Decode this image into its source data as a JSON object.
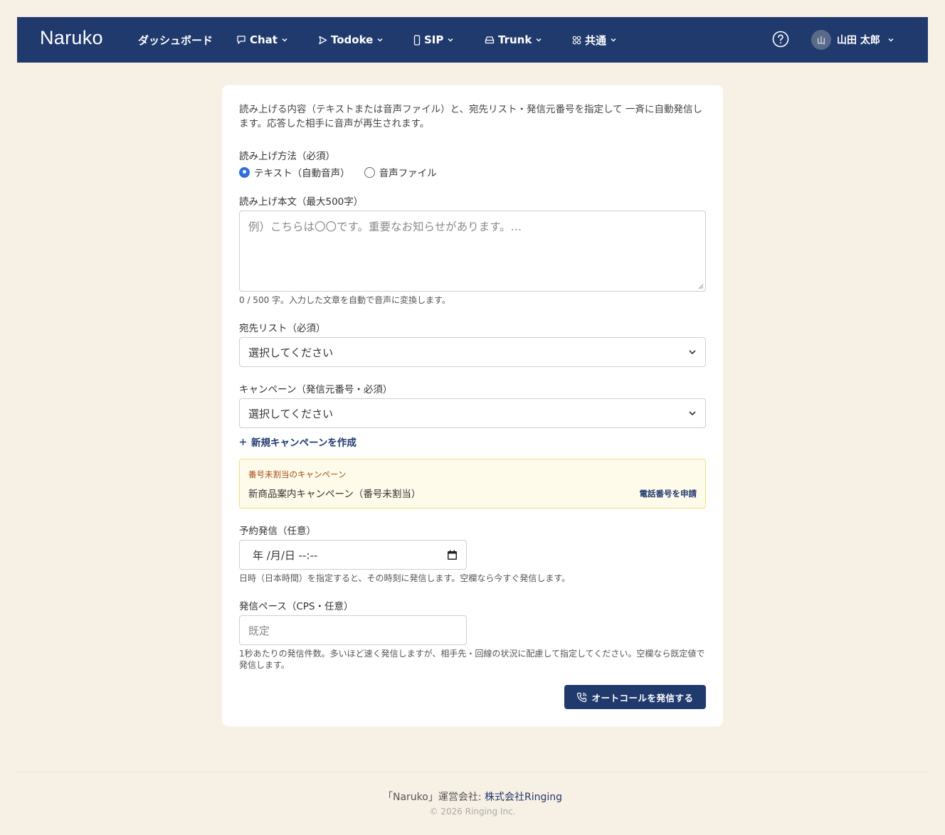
{
  "nav": {
    "brand": "Naruko",
    "dashboard": "ダッシュボード",
    "chat": "Chat",
    "todoke": "Todoke",
    "sip": "SIP",
    "trunk": "Trunk",
    "common": "共通",
    "user_initial": "山",
    "user_name": "山田 太郎"
  },
  "form": {
    "description": "読み上げる内容（テキストまたは音声ファイル）と、宛先リスト・発信元番号を指定して 一斉に自動発信します。応答した相手に音声が再生されます。",
    "method_label": "読み上げ方法（必須）",
    "method_options": [
      {
        "label": "テキスト（自動音声）",
        "checked": true
      },
      {
        "label": "音声ファイル",
        "checked": false
      }
    ],
    "body_label": "読み上げ本文（最大500字）",
    "body_placeholder": "例）こちらは〇〇です。重要なお知らせがあります。…",
    "body_hint": "0 / 500 字。入力した文章を自動で音声に変換します。",
    "list_label": "宛先リスト（必須）",
    "list_value": "選択してください",
    "campaign_label": "キャンペーン（発信元番号・必須）",
    "campaign_value": "選択してください",
    "create_campaign": "新規キャンペーンを作成",
    "alert_title": "番号未割当のキャンペーン",
    "alert_text": "新商品案内キャンペーン（番号未割当）",
    "alert_link": "電話番号を申請",
    "schedule_label": "予約発信（任意）",
    "schedule_value": "年 /月/日 --:--",
    "schedule_hint": "日時（日本時間）を指定すると、その時刻に発信します。空欄なら今すぐ発信します。",
    "pace_label": "発信ペース（CPS・任意）",
    "pace_placeholder": "既定",
    "pace_hint": "1秒あたりの発信件数。多いほど速く発信しますが、相手先・回線の状況に配慮して指定してください。空欄なら既定値で発信します。",
    "submit_label": "オートコールを発信する"
  },
  "footer": {
    "prefix": "「Naruko」運営会社: ",
    "company": "株式会社Ringing",
    "copyright": "© 2026 Ringing Inc."
  },
  "colors": {
    "navbar": "#213a6e",
    "background": "#f7f0e4",
    "accent_radio": "#2f6fe0",
    "alert_bg": "#fffbea"
  }
}
